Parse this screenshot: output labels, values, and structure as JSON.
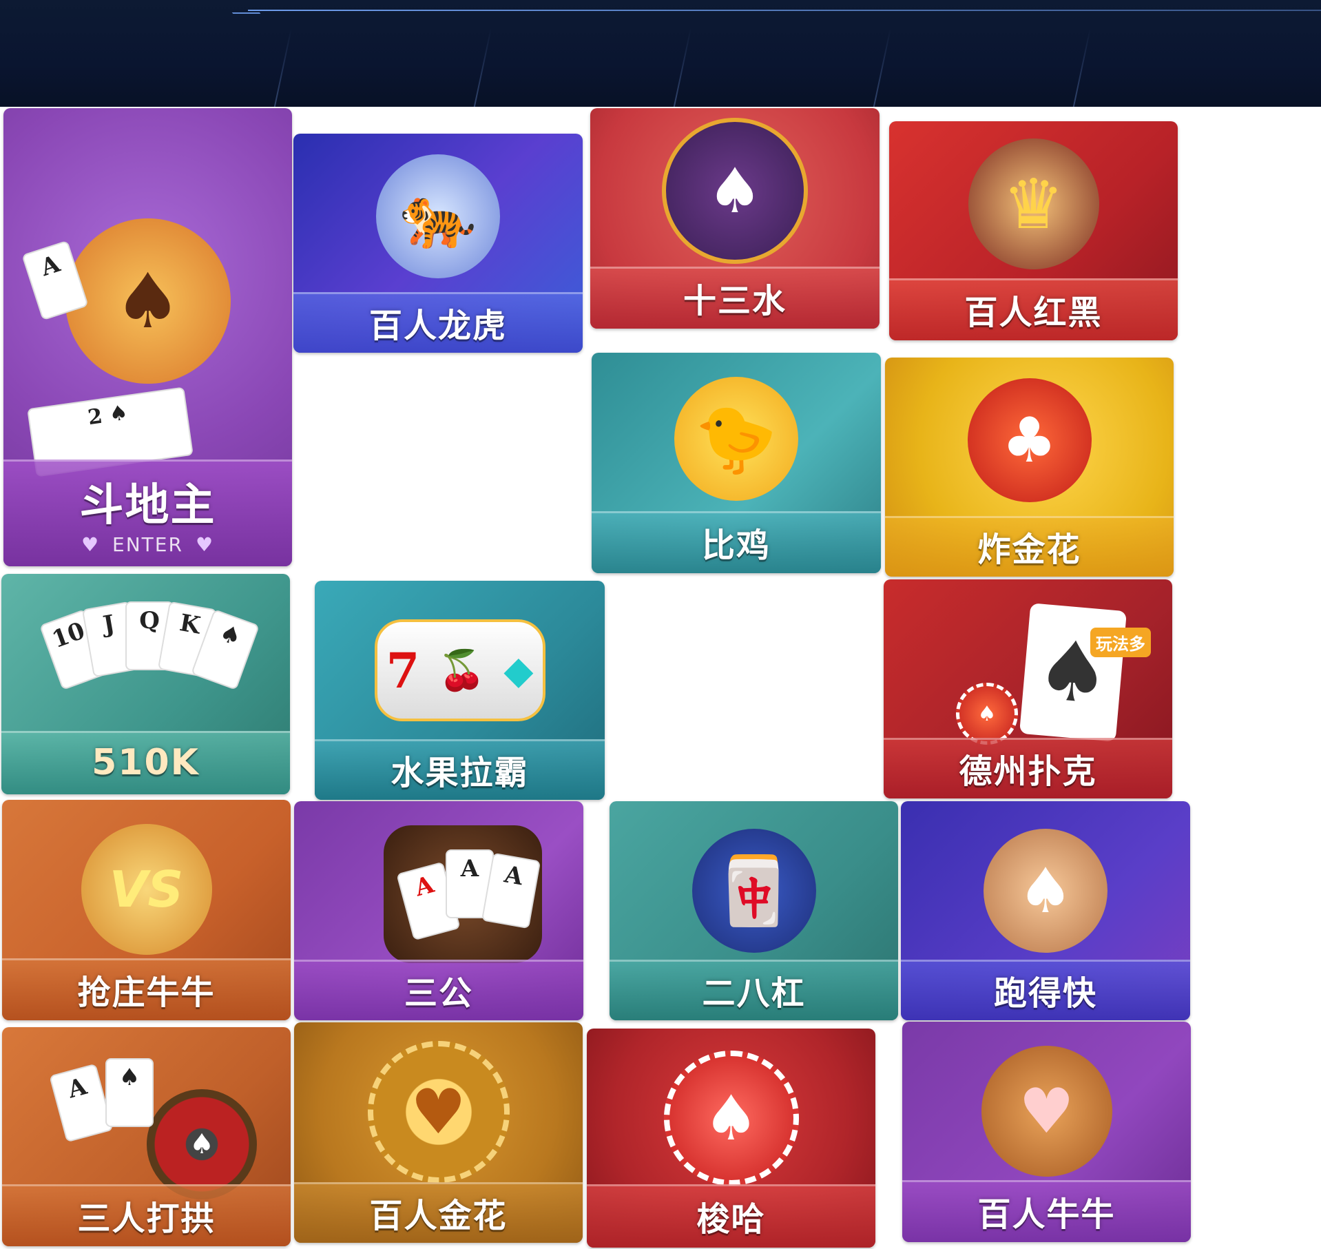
{
  "games": [
    {
      "label": "斗地主",
      "sub": "ENTER",
      "icon": "farmer-boy-icon",
      "glyph": "♠"
    },
    {
      "label": "百人龙虎",
      "icon": "ice-tiger-icon",
      "glyph": "🐅"
    },
    {
      "label": "十三水",
      "icon": "gambler-man-icon",
      "glyph": "♠"
    },
    {
      "label": "百人红黑",
      "icon": "queen-king-icon",
      "glyph": "♛"
    },
    {
      "label": "比鸡",
      "icon": "chick-girl-icon",
      "glyph": "🐤"
    },
    {
      "label": "炸金花",
      "icon": "golden-rocket-icon",
      "glyph": "♣"
    },
    {
      "label": "510K",
      "icon": "poker-hand-icon",
      "glyph": "♠"
    },
    {
      "label": "水果拉霸",
      "icon": "slot-machine-icon",
      "glyph": "7"
    },
    {
      "label": "德州扑克",
      "icon": "spade-card-icon",
      "glyph": "♠",
      "badge": "玩法多"
    },
    {
      "label": "抢庄牛牛",
      "icon": "laughing-bull-icon",
      "glyph": "VS"
    },
    {
      "label": "三公",
      "icon": "aces-chip-icon",
      "glyph": "A"
    },
    {
      "label": "二八杠",
      "icon": "mahjong-lady-icon",
      "glyph": "🀄"
    },
    {
      "label": "跑得快",
      "icon": "donkey-rider-icon",
      "glyph": "♠"
    },
    {
      "label": "三人打拱",
      "icon": "roulette-chips-icon",
      "glyph": "♠"
    },
    {
      "label": "百人金花",
      "icon": "golden-chip-icon",
      "glyph": "♥"
    },
    {
      "label": "梭哈",
      "icon": "crown-trophy-icon",
      "glyph": "♠"
    },
    {
      "label": "百人牛牛",
      "icon": "bull-dice-icon",
      "glyph": "♥"
    }
  ],
  "colors": {
    "topbar": "#0a1530",
    "purple": "#8a47b5",
    "blue": "#4a3cc0",
    "red": "#c8393f",
    "teal": "#3fa0a8",
    "yellow": "#e8b419",
    "orange": "#c8612b",
    "gold": "#b9781f"
  }
}
